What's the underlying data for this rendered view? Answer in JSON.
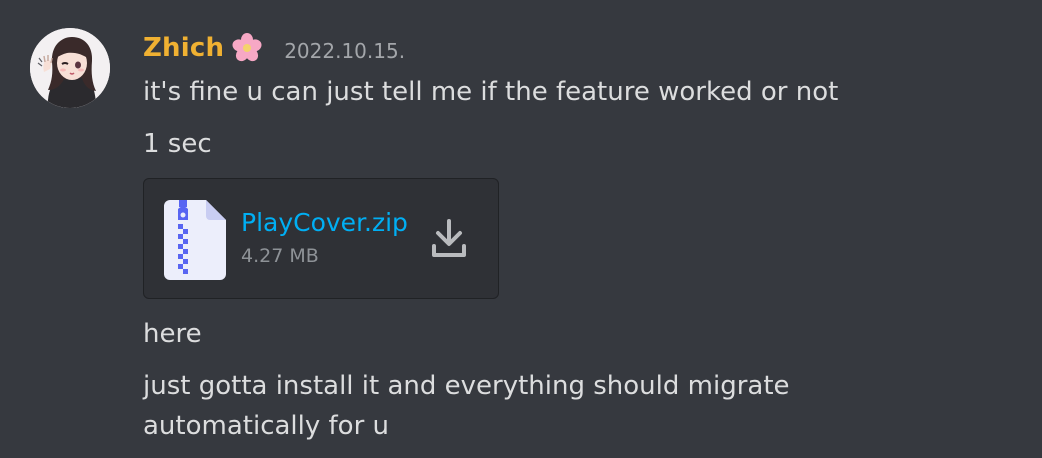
{
  "author": {
    "name": "Zhich",
    "flower_emoji": "🌸",
    "avatar_icon": "anime-avatar",
    "name_color": "#f0b132"
  },
  "timestamp": "2022.10.15.",
  "messages": [
    "it's fine u can just tell me if the feature worked or not",
    "1 sec",
    "here",
    "just gotta install it and everything should migrate",
    "automatically for u"
  ],
  "attachment": {
    "file_name": "PlayCover.zip",
    "file_size": "4.27 MB",
    "file_icon": "zip-file-icon",
    "download_icon": "download-icon",
    "link_color": "#00aff4"
  },
  "colors": {
    "background": "#36393f",
    "text": "#dcddde",
    "muted": "#a3a6aa",
    "attachment_bg": "#2f3136"
  }
}
